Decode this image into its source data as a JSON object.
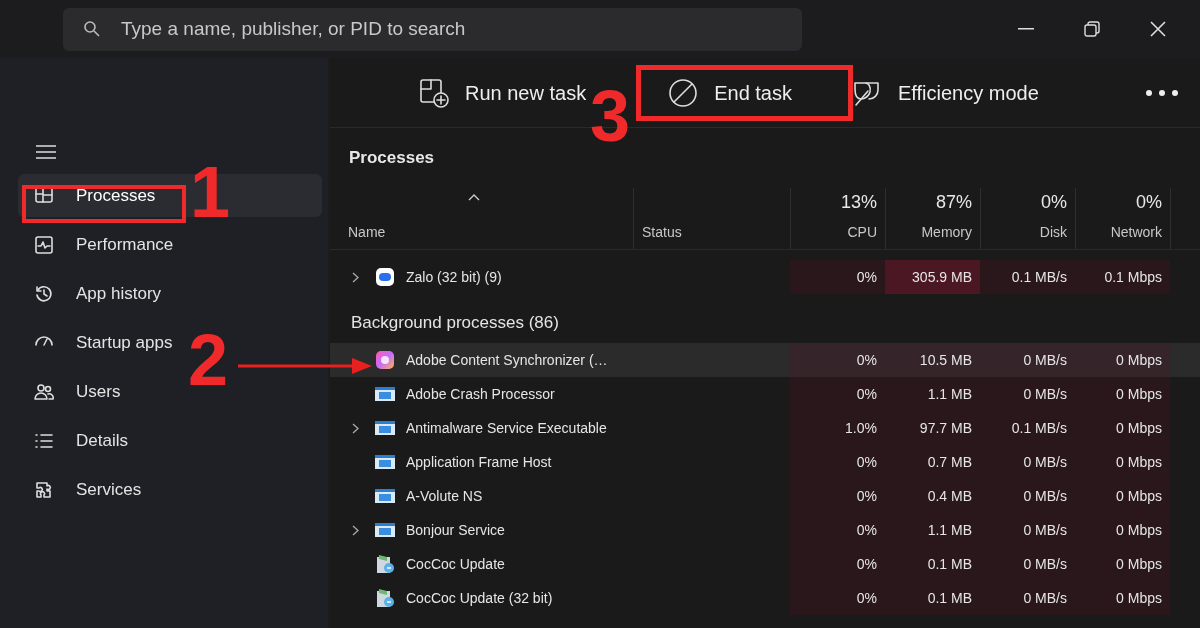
{
  "search": {
    "placeholder": "Type a name, publisher, or PID to search"
  },
  "sidebar": {
    "items": [
      {
        "label": "Processes",
        "selected": true
      },
      {
        "label": "Performance",
        "selected": false
      },
      {
        "label": "App history",
        "selected": false
      },
      {
        "label": "Startup apps",
        "selected": false
      },
      {
        "label": "Users",
        "selected": false
      },
      {
        "label": "Details",
        "selected": false
      },
      {
        "label": "Services",
        "selected": false
      }
    ]
  },
  "toolbar": [
    {
      "label": "Run new task"
    },
    {
      "label": "End task"
    },
    {
      "label": "Efficiency mode"
    }
  ],
  "page_title": "Processes",
  "table": {
    "columns": [
      {
        "label": "Name"
      },
      {
        "label": "Status"
      },
      {
        "label": "CPU",
        "total": "13%"
      },
      {
        "label": "Memory",
        "total": "87%"
      },
      {
        "label": "Disk",
        "total": "0%"
      },
      {
        "label": "Network",
        "total": "0%"
      }
    ],
    "apps": [
      {
        "name": "Zalo (32 bit) (9)",
        "kind": "chat",
        "expandable": true,
        "selected": false,
        "memory_high": true,
        "cpu": "0%",
        "memory": "305.9 MB",
        "disk": "0.1 MB/s",
        "network": "0.1 Mbps"
      }
    ],
    "group_title": "Background processes (86)",
    "rows": [
      {
        "name": "Adobe Content Synchronizer (…",
        "kind": "gradient",
        "expandable": false,
        "selected": true,
        "memory_high": false,
        "cpu": "0%",
        "memory": "10.5 MB",
        "disk": "0 MB/s",
        "network": "0 Mbps"
      },
      {
        "name": "Adobe Crash Processor",
        "kind": "window",
        "expandable": false,
        "selected": false,
        "memory_high": false,
        "cpu": "0%",
        "memory": "1.1 MB",
        "disk": "0 MB/s",
        "network": "0 Mbps"
      },
      {
        "name": "Antimalware Service Executable",
        "kind": "window",
        "expandable": true,
        "selected": false,
        "memory_high": false,
        "cpu": "1.0%",
        "memory": "97.7 MB",
        "disk": "0.1 MB/s",
        "network": "0 Mbps"
      },
      {
        "name": "Application Frame Host",
        "kind": "window",
        "expandable": false,
        "selected": false,
        "memory_high": false,
        "cpu": "0%",
        "memory": "0.7 MB",
        "disk": "0 MB/s",
        "network": "0 Mbps"
      },
      {
        "name": "A-Volute NS",
        "kind": "window",
        "expandable": false,
        "selected": false,
        "memory_high": false,
        "cpu": "0%",
        "memory": "0.4 MB",
        "disk": "0 MB/s",
        "network": "0 Mbps"
      },
      {
        "name": "Bonjour Service",
        "kind": "window",
        "expandable": true,
        "selected": false,
        "memory_high": false,
        "cpu": "0%",
        "memory": "1.1 MB",
        "disk": "0 MB/s",
        "network": "0 Mbps"
      },
      {
        "name": "CocCoc Update",
        "kind": "installer",
        "expandable": false,
        "selected": false,
        "memory_high": false,
        "cpu": "0%",
        "memory": "0.1 MB",
        "disk": "0 MB/s",
        "network": "0 Mbps"
      },
      {
        "name": "CocCoc Update (32 bit)",
        "kind": "installer",
        "expandable": false,
        "selected": false,
        "memory_high": false,
        "cpu": "0%",
        "memory": "0.1 MB",
        "disk": "0 MB/s",
        "network": "0 Mbps"
      }
    ]
  },
  "annotations": [
    "1",
    "2",
    "3"
  ]
}
